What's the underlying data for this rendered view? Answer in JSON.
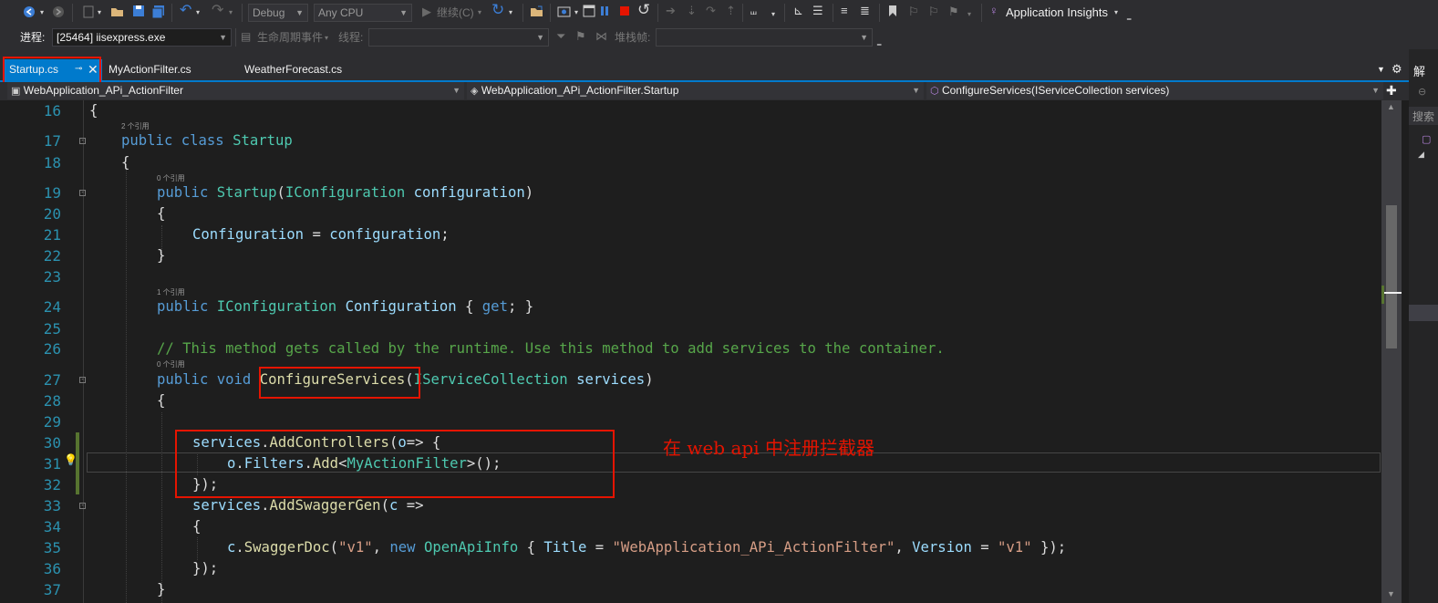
{
  "toolbar": {
    "config": "Debug",
    "platform": "Any CPU",
    "continue_label": "继续(C)",
    "app_insights": "Application Insights"
  },
  "process_bar": {
    "process_label": "进程:",
    "process_value": "[25464] iisexpress.exe",
    "lifecycle_label": "生命周期事件",
    "thread_label": "线程:",
    "stackframe_label": "堆栈帧:"
  },
  "tabs": [
    {
      "label": "Startup.cs",
      "active": true
    },
    {
      "label": "MyActionFilter.cs",
      "active": false
    },
    {
      "label": "WeatherForecast.cs",
      "active": false
    }
  ],
  "nav": {
    "project": "WebApplication_APi_ActionFilter",
    "class": "WebApplication_APi_ActionFilter.Startup",
    "member": "ConfigureServices(IServiceCollection services)"
  },
  "right_pane": {
    "title": "解",
    "search": "搜索"
  },
  "code_lines": [
    {
      "n": "16",
      "code": "{"
    },
    {
      "n": "17",
      "hint": "2 个引用",
      "code": "public class Startup"
    },
    {
      "n": "18",
      "code": "{"
    },
    {
      "n": "19",
      "hint": "0 个引用",
      "code": "public Startup(IConfiguration configuration)"
    },
    {
      "n": "20",
      "code": "{"
    },
    {
      "n": "21",
      "code": "Configuration = configuration;"
    },
    {
      "n": "22",
      "code": "}"
    },
    {
      "n": "23",
      "code": ""
    },
    {
      "n": "24",
      "hint": "1 个引用",
      "code": "public IConfiguration Configuration { get; }"
    },
    {
      "n": "25",
      "code": ""
    },
    {
      "n": "26",
      "code": "// This method gets called by the runtime. Use this method to add services to the container."
    },
    {
      "n": "27",
      "hint": "0 个引用",
      "code": "public void ConfigureServices(IServiceCollection services)"
    },
    {
      "n": "28",
      "code": "{"
    },
    {
      "n": "29",
      "code": ""
    },
    {
      "n": "30",
      "code": "services.AddControllers(o=> {"
    },
    {
      "n": "31",
      "code": "o.Filters.Add<MyActionFilter>();"
    },
    {
      "n": "32",
      "code": "});"
    },
    {
      "n": "33",
      "code": "services.AddSwaggerGen(c =>"
    },
    {
      "n": "34",
      "code": "{"
    },
    {
      "n": "35",
      "code": "c.SwaggerDoc(\"v1\", new OpenApiInfo { Title = \"WebApplication_APi_ActionFilter\", Version = \"v1\" });"
    },
    {
      "n": "36",
      "code": "});"
    },
    {
      "n": "37",
      "code": "}"
    }
  ],
  "annotation": "在 web api 中注册拦截器"
}
